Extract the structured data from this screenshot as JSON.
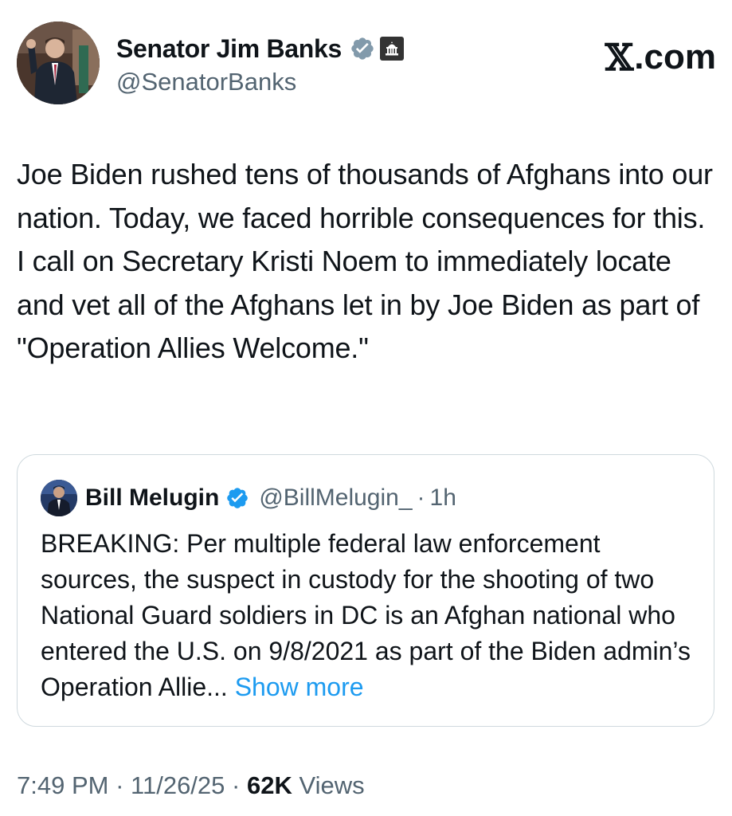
{
  "author": {
    "name": "Senator Jim Banks",
    "handle": "@SenatorBanks",
    "verified_icon": "verified-badge-icon",
    "government_icon": "capitol-building-icon"
  },
  "branding": {
    "logo_mark": "𝕏",
    "logo_text": ".com"
  },
  "tweet": {
    "text": "Joe Biden rushed tens of thousands of Afghans into our nation. Today, we faced horrible consequences for this. I call on Secretary Kristi Noem to immediately locate and vet all of the Afghans let in by Joe Biden as part of \"Operation Allies Welcome.\""
  },
  "quote": {
    "name": "Bill Melugin",
    "handle": "@BillMelugin_",
    "separator": "·",
    "time": "1h",
    "text": "BREAKING: Per multiple federal law enforcement sources, the suspect in custody for the shooting of two National Guard soldiers in DC is an Afghan national who entered the U.S. on 9/8/2021 as part of the Biden admin’s Operation Allie...",
    "show_more": "Show more"
  },
  "meta": {
    "time": "7:49 PM",
    "date": "11/26/25",
    "separator": "·",
    "views_count": "62K",
    "views_label": "Views"
  },
  "colors": {
    "text_primary": "#0f1419",
    "text_secondary": "#536471",
    "link_blue": "#1d9bf0",
    "verified_blue": "#1d9bf0",
    "border": "#cfd9de"
  }
}
